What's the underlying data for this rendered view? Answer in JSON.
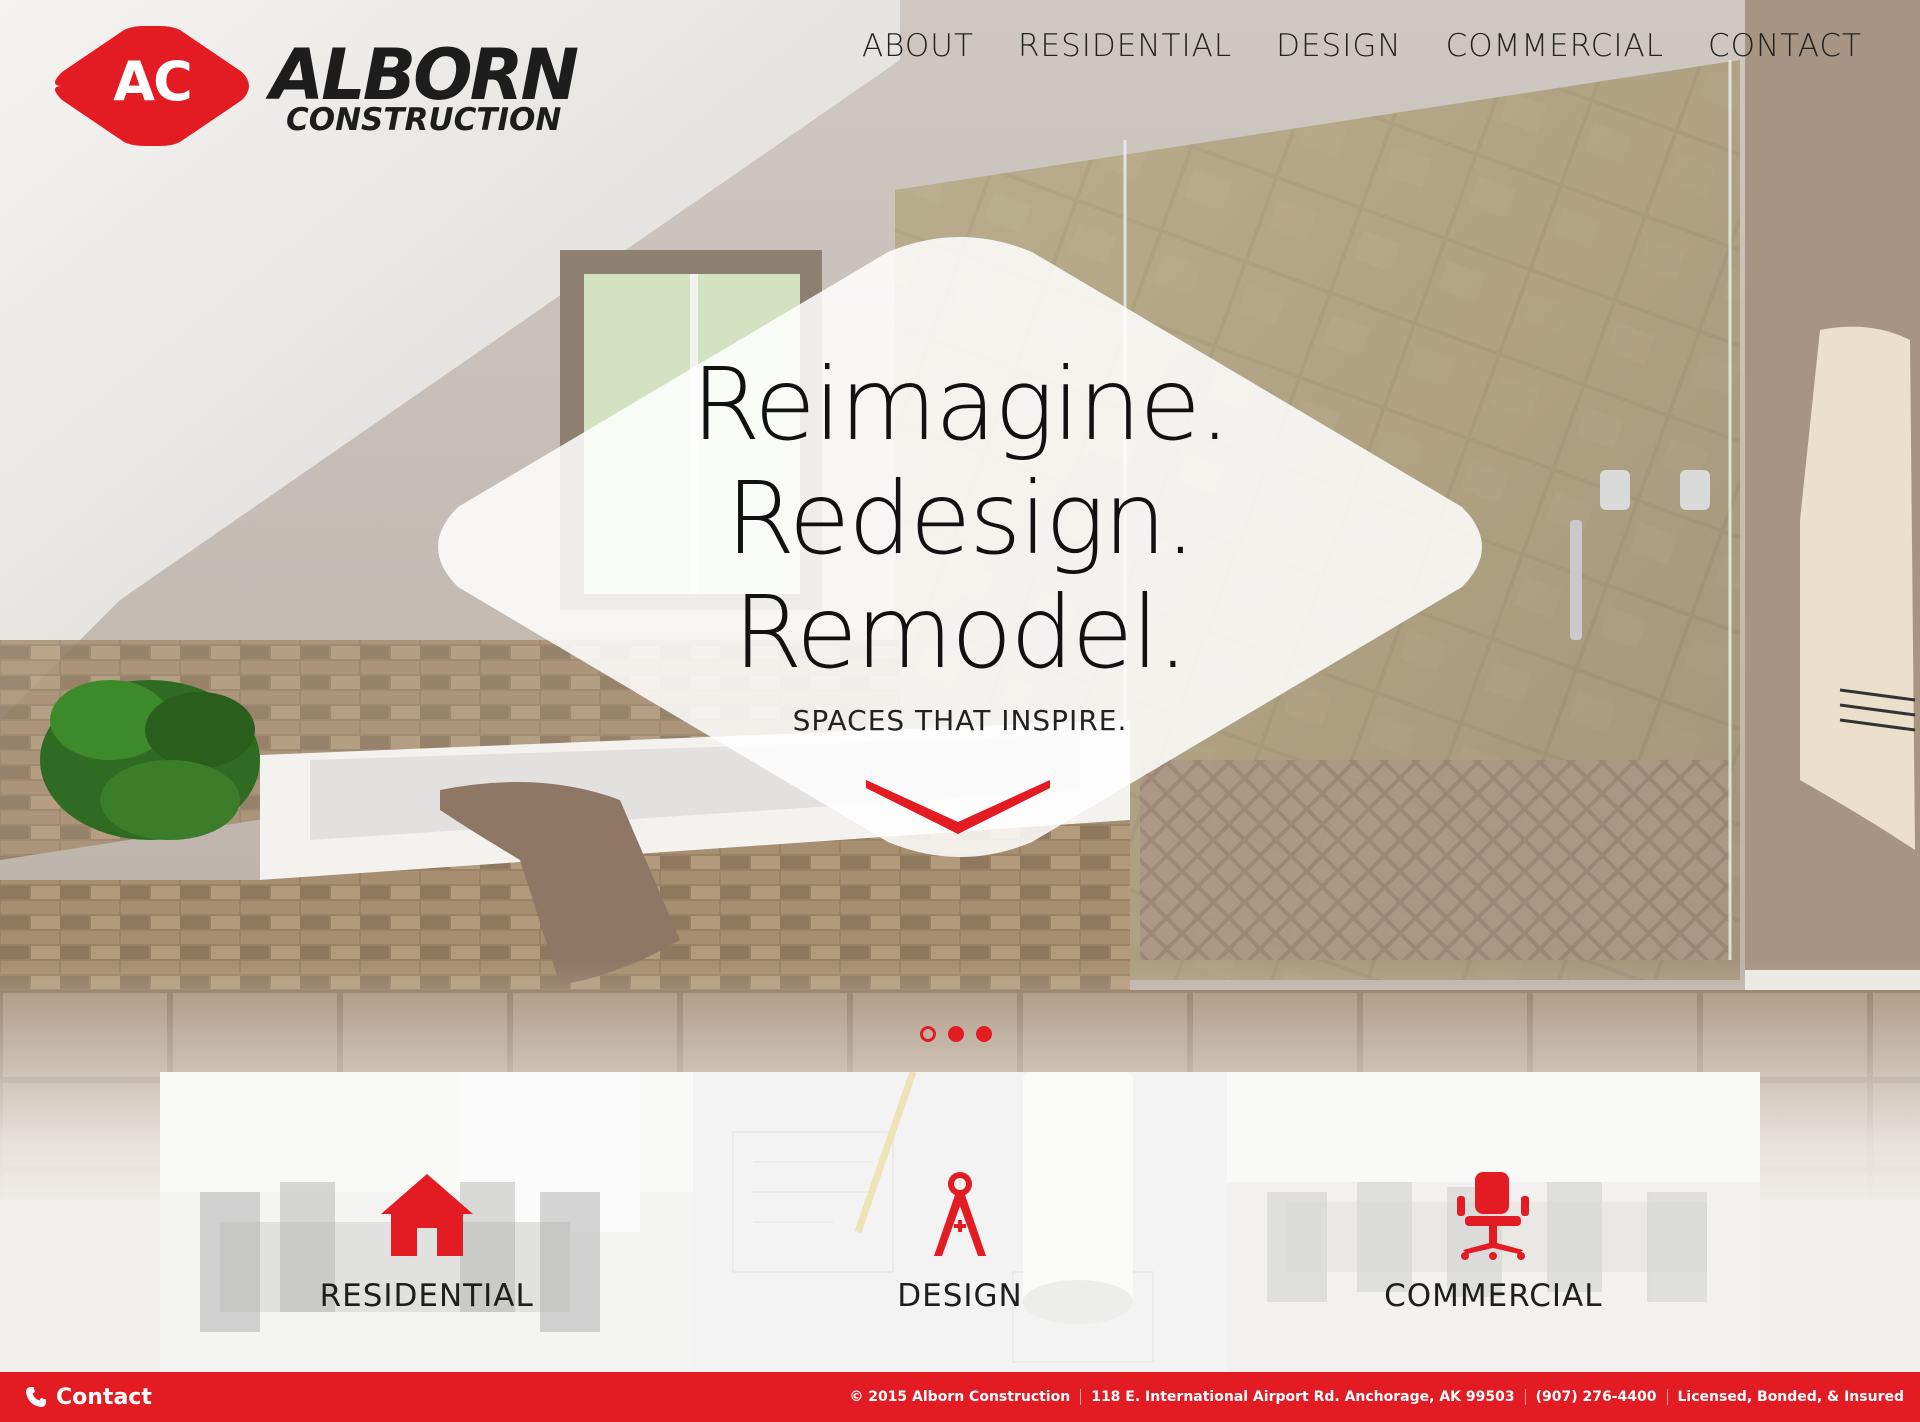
{
  "brand": {
    "badge_text": "AC",
    "name": "ALBORN",
    "subtitle": "CONSTRUCTION",
    "accent_color": "#e31b23"
  },
  "nav": {
    "items": [
      {
        "label": "ABOUT"
      },
      {
        "label": "RESIDENTIAL"
      },
      {
        "label": "DESIGN"
      },
      {
        "label": "COMMERCIAL"
      },
      {
        "label": "CONTACT"
      }
    ]
  },
  "hero": {
    "headline": [
      "Reimagine.",
      "Redesign.",
      "Remodel."
    ],
    "tagline": "SPACES THAT INSPIRE.",
    "scroll_icon": "chevron-down-icon",
    "slides_total": 3,
    "active_slide": 1
  },
  "services": [
    {
      "label": "RESIDENTIAL",
      "icon": "house-icon"
    },
    {
      "label": "DESIGN",
      "icon": "compass-icon"
    },
    {
      "label": "COMMERCIAL",
      "icon": "office-chair-icon"
    }
  ],
  "footer": {
    "contact_label": "Contact",
    "contact_icon": "phone-icon",
    "copyright": "© 2015 Alborn Construction",
    "address": "118 E. International Airport Rd. Anchorage, AK 99503",
    "phone": "(907) 276-4400",
    "license": "Licensed, Bonded, & Insured"
  }
}
